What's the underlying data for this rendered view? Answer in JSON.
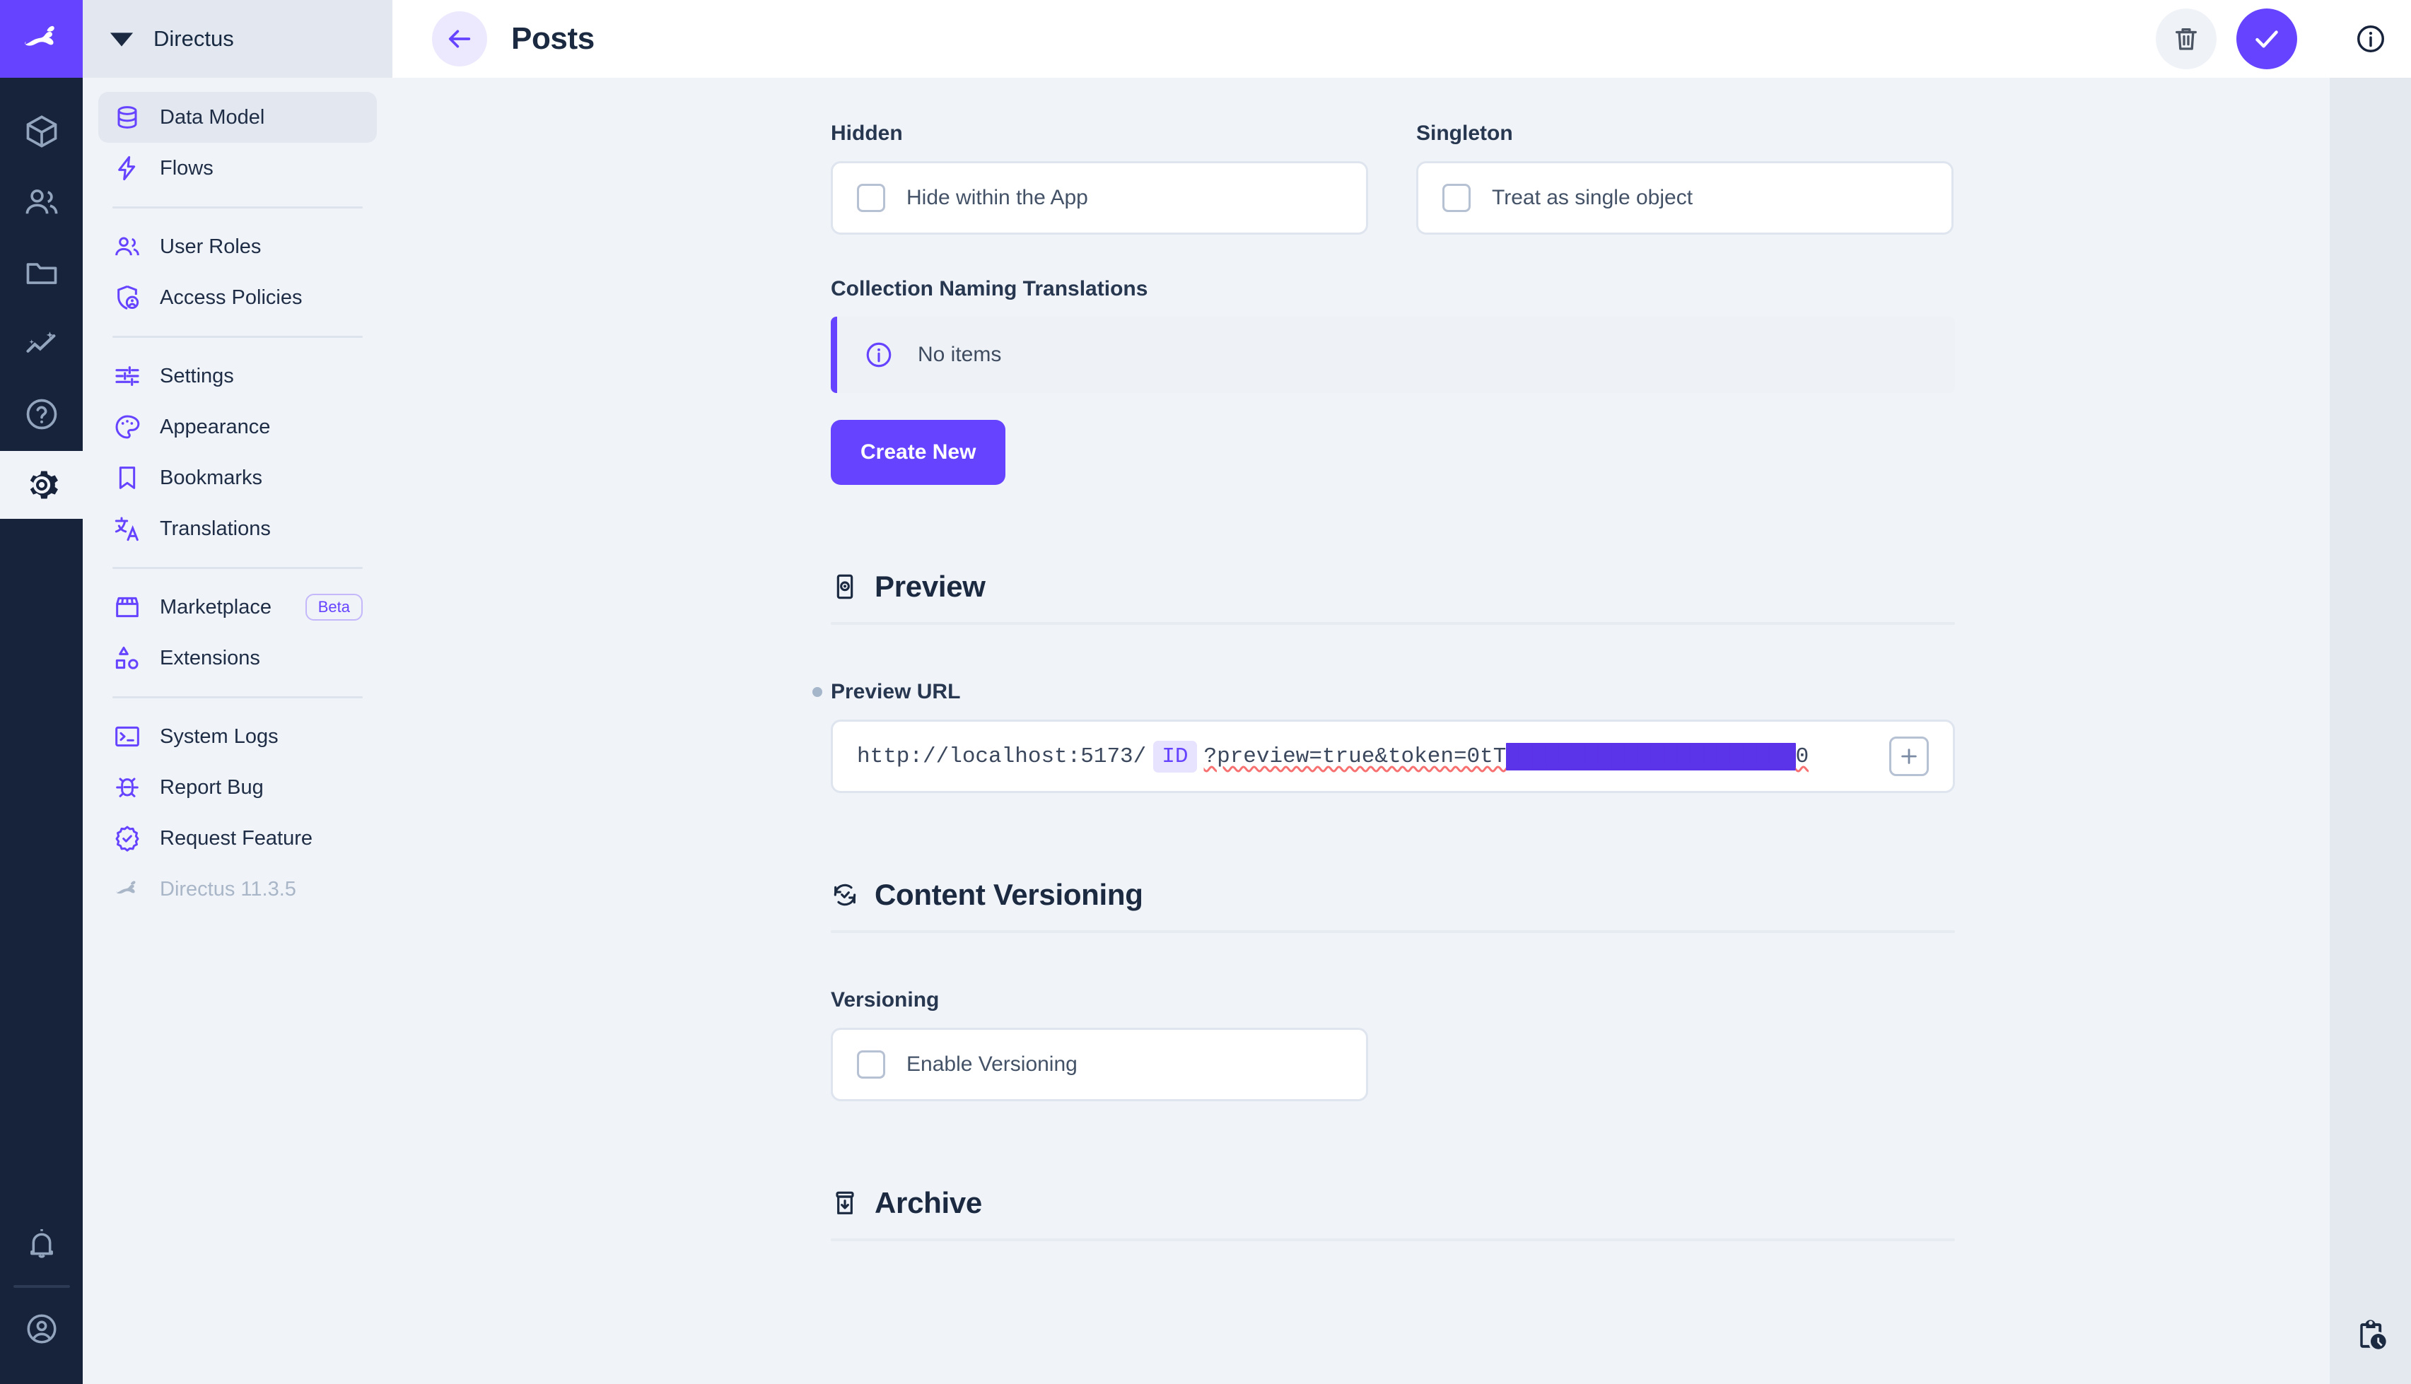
{
  "brand": {
    "name": "Directus",
    "logo_icon": "rabbit-logo-icon",
    "accent": "#6644ff"
  },
  "module_rail": {
    "items": [
      {
        "name": "content",
        "icon": "box-icon",
        "active": false
      },
      {
        "name": "users",
        "icon": "users-icon",
        "active": false
      },
      {
        "name": "files",
        "icon": "folder-icon",
        "active": false
      },
      {
        "name": "insights",
        "icon": "sparkline-icon",
        "active": false
      },
      {
        "name": "docs",
        "icon": "help-circle-icon",
        "active": false
      },
      {
        "name": "settings",
        "icon": "gear-icon",
        "active": true
      }
    ],
    "bottom": [
      {
        "name": "notifications",
        "icon": "bell-icon"
      },
      {
        "name": "user-menu",
        "icon": "account-circle-icon"
      }
    ]
  },
  "sidebar": {
    "title": "Directus",
    "title_icon": "directus-mark-icon",
    "groups": [
      {
        "items": [
          {
            "label": "Data Model",
            "icon": "database-icon",
            "active": true
          },
          {
            "label": "Flows",
            "icon": "bolt-icon",
            "active": false
          }
        ]
      },
      {
        "items": [
          {
            "label": "User Roles",
            "icon": "users-icon",
            "active": false
          },
          {
            "label": "Access Policies",
            "icon": "shield-person-icon",
            "active": false
          }
        ]
      },
      {
        "items": [
          {
            "label": "Settings",
            "icon": "tune-icon",
            "active": false
          },
          {
            "label": "Appearance",
            "icon": "palette-icon",
            "active": false
          },
          {
            "label": "Bookmarks",
            "icon": "bookmark-icon",
            "active": false
          },
          {
            "label": "Translations",
            "icon": "translate-icon",
            "active": false
          }
        ]
      },
      {
        "items": [
          {
            "label": "Marketplace",
            "icon": "storefront-icon",
            "badge": "Beta",
            "active": false
          },
          {
            "label": "Extensions",
            "icon": "extension-shapes-icon",
            "active": false
          }
        ]
      },
      {
        "items": [
          {
            "label": "System Logs",
            "icon": "terminal-icon",
            "active": false
          },
          {
            "label": "Report Bug",
            "icon": "bug-icon",
            "active": false
          },
          {
            "label": "Request Feature",
            "icon": "verified-icon",
            "active": false
          },
          {
            "label": "Directus 11.3.5",
            "icon": "rabbit-logo-icon",
            "active": false,
            "dim": true
          }
        ]
      }
    ]
  },
  "header": {
    "back_icon": "arrow-left-icon",
    "title": "Posts",
    "actions": [
      {
        "name": "delete-collection",
        "icon": "trash-icon",
        "style": "ghost"
      },
      {
        "name": "save-collection",
        "icon": "check-icon",
        "style": "primary"
      }
    ]
  },
  "right_sidebar": {
    "info_icon": "info-circle-icon",
    "revisions_icon": "clipboard-clock-icon"
  },
  "main": {
    "hidden": {
      "label": "Hidden",
      "checkbox_label": "Hide within the App",
      "checked": false
    },
    "singleton": {
      "label": "Singleton",
      "checkbox_label": "Treat as single object",
      "checked": false
    },
    "translations": {
      "label": "Collection Naming Translations",
      "notice_icon": "info-circle-icon",
      "notice_text": "No items",
      "create_button": "Create New"
    },
    "preview": {
      "section_title": "Preview",
      "section_icon": "preview-phone-icon",
      "field_label": "Preview URL",
      "required": true,
      "url_prefix": "http://localhost:5173/",
      "url_chip": "ID",
      "url_suffix": "?preview=true&token=0tT",
      "url_redacted_token": "██████████████████████",
      "url_tail": "0",
      "add_button_icon": "add-box-icon"
    },
    "versioning": {
      "section_title": "Content Versioning",
      "section_icon": "versions-check-icon",
      "field_label": "Versioning",
      "checkbox_label": "Enable Versioning",
      "checked": false
    },
    "archive": {
      "section_title": "Archive",
      "section_icon": "archive-icon"
    }
  }
}
